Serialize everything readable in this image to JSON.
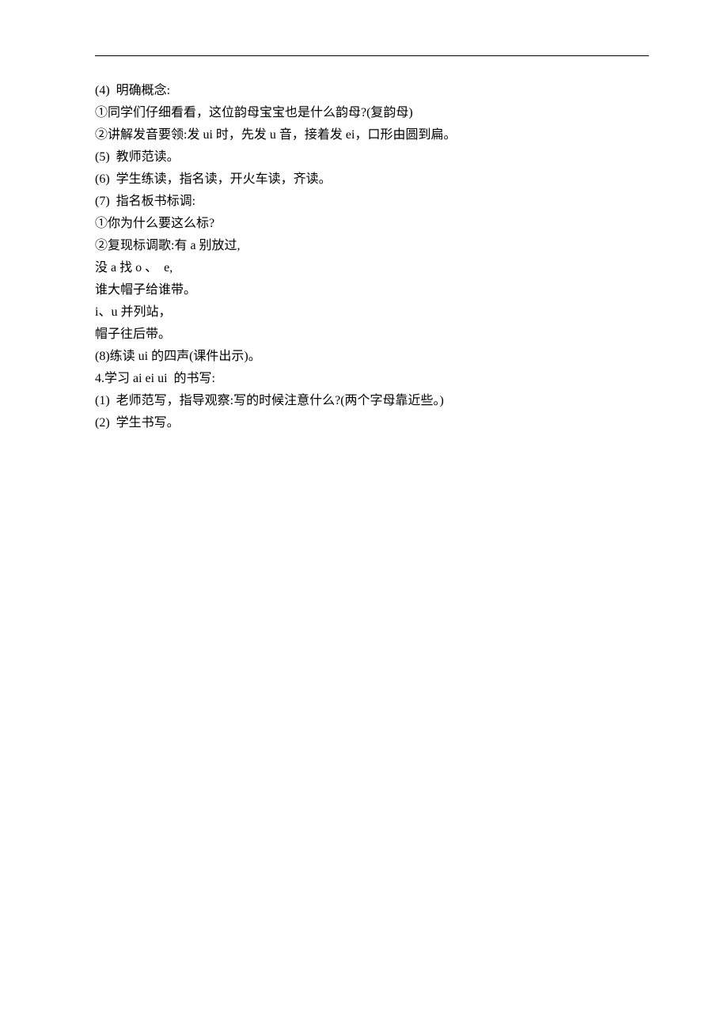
{
  "lines": [
    "(4)  明确概念:",
    "①同学们仔细看看，这位韵母宝宝也是什么韵母?(复韵母)",
    "②讲解发音要领:发 ui 时，先发 u 音，接着发 ei，口形由圆到扁。",
    "(5)  教师范读。",
    "(6)  学生练读，指名读，开火车读，齐读。",
    "(7)  指名板书标调:",
    "①你为什么要这么标?",
    "②复现标调歌:有 a 别放过,",
    "没 a 找 o 、  e,",
    "谁大帽子给谁带。",
    "i、u 并列站，",
    "帽子往后带。",
    "(8)练读 ui 的四声(课件出示)。",
    "4.学习 ai ei ui  的书写:",
    "(1)  老师范写，指导观察:写的时候注意什么?(两个字母靠近些。)",
    "(2)  学生书写。"
  ]
}
